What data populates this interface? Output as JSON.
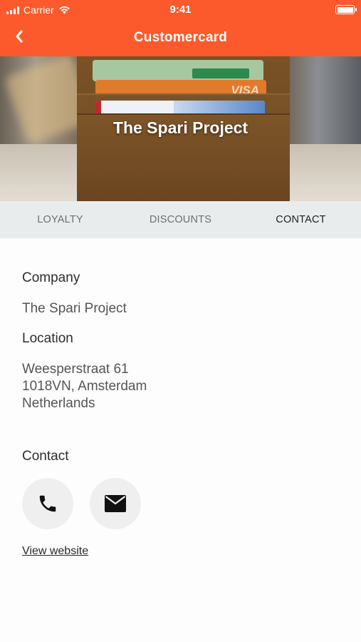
{
  "status_bar": {
    "carrier": "Carrier",
    "time": "9:41"
  },
  "nav": {
    "title": "Customercard",
    "back_icon": "chevron-left-icon"
  },
  "hero": {
    "title": "The Spari Project",
    "card_brand": "VISA"
  },
  "tabs": [
    {
      "label": "LOYALTY",
      "active": false
    },
    {
      "label": "DISCOUNTS",
      "active": false
    },
    {
      "label": "CONTACT",
      "active": true
    }
  ],
  "contact": {
    "company_label": "Company",
    "company_value": "The Spari Project",
    "location_label": "Location",
    "address_lines": [
      "Weesperstraat 61",
      "1018VN, Amsterdam",
      "Netherlands"
    ],
    "contact_label": "Contact",
    "phone_icon": "phone-icon",
    "email_icon": "envelope-icon",
    "website_link": "View website"
  },
  "colors": {
    "accent": "#fc5a2c",
    "tab_bar": "#e9eced",
    "button_bg": "#efefef"
  }
}
